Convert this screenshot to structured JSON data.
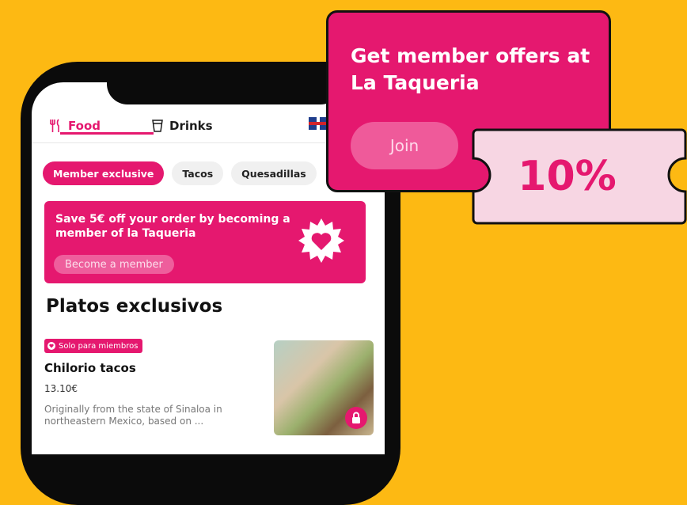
{
  "tabs": {
    "food": "Food",
    "drinks": "Drinks"
  },
  "chips": [
    "Member exclusive",
    "Tacos",
    "Quesadillas"
  ],
  "banner": {
    "text": "Save 5€ off your order by becoming a member of la Taqueria",
    "button": "Become a member"
  },
  "section_title": "Platos exclusivos",
  "dish": {
    "badge": "Solo para miembros",
    "name": "Chilorio tacos",
    "price": "13.10€",
    "description": "Originally from the state of Sinaloa in northeastern Mexico, based on ..."
  },
  "offer": {
    "title": "Get member offers at La Taqueria",
    "join_label": "Join"
  },
  "coupon": {
    "value": "10%"
  },
  "colors": {
    "accent": "#E5186F",
    "background": "#FDB913",
    "coupon_bg": "#F7D6E3"
  },
  "icons": [
    "fork-knife-icon",
    "cup-icon",
    "uk-flag-icon",
    "heart-badge-icon",
    "heart-icon",
    "lock-icon"
  ]
}
